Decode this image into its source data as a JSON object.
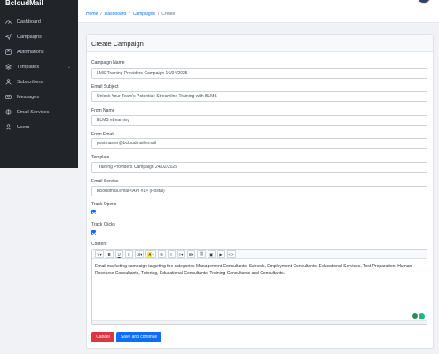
{
  "app": {
    "brand": "BcloudMail"
  },
  "sidebar": {
    "items": [
      {
        "label": "Dashboard",
        "icon": "dashboard-icon"
      },
      {
        "label": "Campaigns",
        "icon": "paper-plane-icon"
      },
      {
        "label": "Automations",
        "icon": "automation-icon"
      },
      {
        "label": "Templates",
        "icon": "templates-icon"
      },
      {
        "label": "Subscribers",
        "icon": "subscribers-icon"
      },
      {
        "label": "Messages",
        "icon": "messages-icon"
      },
      {
        "label": "Email Services",
        "icon": "email-services-icon"
      },
      {
        "label": "Users",
        "icon": "users-icon"
      }
    ]
  },
  "breadcrumb": {
    "home": "Home",
    "sep": "/",
    "dashboard": "Dashboard",
    "campaigns": "Campaigns",
    "current": "Create"
  },
  "form": {
    "title": "Create Campaign",
    "campaign_name": {
      "label": "Campaign Name",
      "value": "LMS Training Providers Campaign 16/04/2025"
    },
    "email_subject": {
      "label": "Email Subject",
      "value": "Unlock Your Team's Potential: Streamline Training with BLMS"
    },
    "from_name": {
      "label": "From Name",
      "value": "BLMS eLearning"
    },
    "from_email": {
      "label": "From Email",
      "value": "postmaster@bcloudmail.email"
    },
    "template": {
      "label": "Template",
      "value": "Training Providers Campaign 24/02/2025"
    },
    "email_service": {
      "label": "Email Service",
      "value": "bcloudmail.email<API #1> (Postal)"
    },
    "track_opens": {
      "label": "Track Opens",
      "checked": true
    },
    "track_clicks": {
      "label": "Track Clicks",
      "checked": true
    },
    "content": {
      "label": "Content",
      "toolbar": {
        "font_size": "16"
      },
      "body": "Email marketing campaign targeting the categories Management Consultants, Schools, Employment Consultants, Educational Services, Test Preparation, Human Resource Consultants, Tutoring, Educational Consultants, Training Consultants and Consultants."
    },
    "buttons": {
      "cancel": "Cancel",
      "save": "Save and continue"
    }
  },
  "colors": {
    "primary": "#0d6efd",
    "danger": "#dc3545",
    "sidebar": "#212529"
  }
}
